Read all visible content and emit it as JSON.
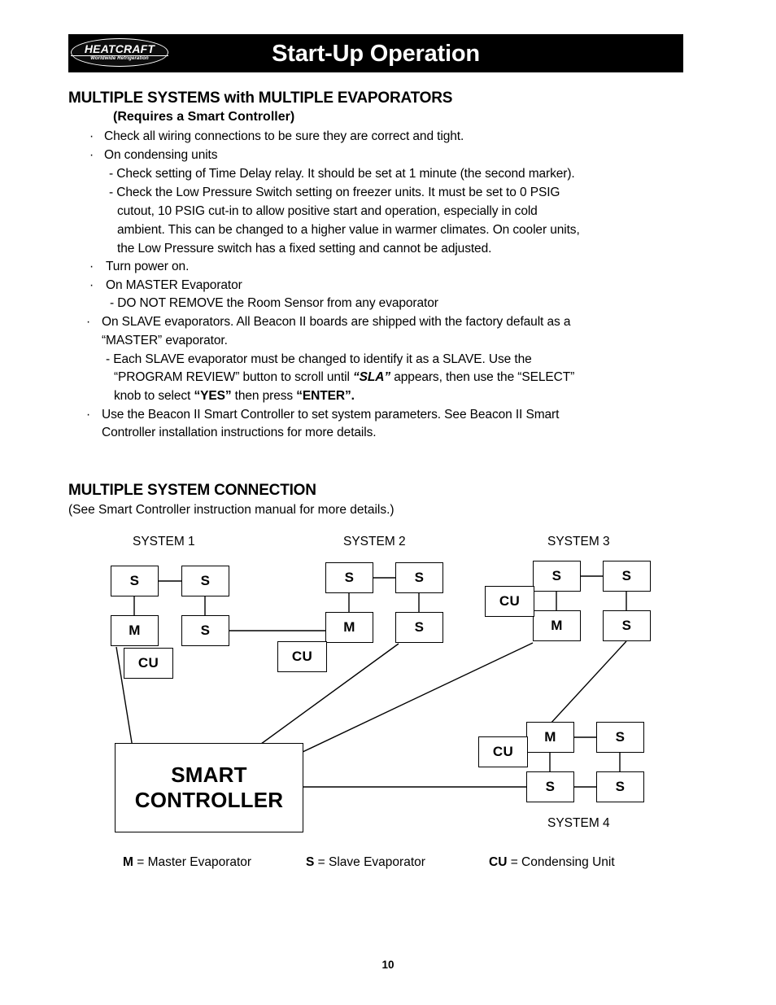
{
  "header": {
    "title": "Start-Up Operation",
    "logo_main": "HEATCRAFT",
    "logo_sub": "Worldwide Refrigeration",
    "band_color": "#000000"
  },
  "section1": {
    "heading": "MULTIPLE SYSTEMS with MULTIPLE EVAPORATORS",
    "subheading": "(Requires a Smart Controller)",
    "lines": [
      "Check all wiring connections to be sure they are correct and tight.",
      "On condensing units",
      "- Check setting of Time Delay relay. It should be set at 1 minute (the second marker).",
      "- Check the Low Pressure Switch setting on freezer units. It must be set to 0 PSIG",
      "cutout, 10 PSIG cut-in to allow positive start and operation, especially in cold",
      "ambient. This can be changed to a higher value in warmer climates. On cooler units,",
      "the Low Pressure switch has a fixed setting and cannot be adjusted.",
      "Turn power on.",
      "On MASTER Evaporator",
      "- DO NOT REMOVE the Room Sensor from any evaporator",
      "On SLAVE evaporators. All Beacon II boards are shipped with the factory default as a",
      "“MASTER” evaporator.",
      "- Each SLAVE evaporator must be changed to identify it as a SLAVE.  Use the",
      "knob to select ",
      "Use the Beacon II Smart Controller to set system parameters.  See Beacon II Smart",
      "Controller installation instructions for more details."
    ],
    "prog_review_a": "“PROGRAM REVIEW” button to scroll until ",
    "prog_review_sla": "“SLA”",
    "prog_review_b": " appears, then use the “SELECT”",
    "knob_a": "knob to select ",
    "knob_yes": "“YES”",
    "knob_b": " then press ",
    "knob_enter": "“ENTER”.",
    "bullet_char": "·"
  },
  "section2": {
    "heading": "MULTIPLE SYSTEM CONNECTION",
    "note": "(See Smart Controller instruction manual for more details.)"
  },
  "diagram": {
    "systems": [
      {
        "label": "SYSTEM 1"
      },
      {
        "label": "SYSTEM 2"
      },
      {
        "label": "SYSTEM 3"
      },
      {
        "label": "SYSTEM 4"
      }
    ],
    "smart_controller_line1": "SMART",
    "smart_controller_line2": "CONTROLLER",
    "node_master": "M",
    "node_slave": "S",
    "node_cu": "CU",
    "sys1_nodes": [
      "S",
      "S",
      "M",
      "S",
      "CU"
    ],
    "sys2_nodes": [
      "S",
      "S",
      "M",
      "S",
      "CU"
    ],
    "sys3_nodes": [
      "S",
      "S",
      "M",
      "S",
      "CU"
    ],
    "sys4_nodes": [
      "M",
      "S",
      "S",
      "S",
      "CU"
    ]
  },
  "legend": {
    "m_key": "M",
    "m_text": " = Master Evaporator",
    "s_key": "S",
    "s_text": " = Slave Evaporator",
    "cu_key": "CU",
    "cu_text": " = Condensing Unit"
  },
  "footer": {
    "page_number": "10"
  }
}
